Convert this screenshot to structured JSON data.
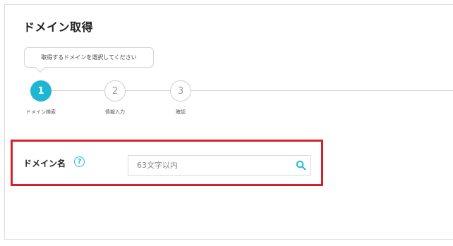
{
  "page": {
    "title": "ドメイン取得"
  },
  "tooltip": {
    "text": "取得するドメインを選択してください"
  },
  "steps": [
    {
      "number": "1",
      "label": "ドメイン検索",
      "active": true
    },
    {
      "number": "2",
      "label": "情報入力",
      "active": false
    },
    {
      "number": "3",
      "label": "確認",
      "active": false
    }
  ],
  "domain_search": {
    "label": "ドメイン名",
    "help_symbol": "?",
    "placeholder": "63文字以内",
    "value": ""
  },
  "colors": {
    "accent": "#1db7d4",
    "highlight_border": "#d1232a"
  },
  "icons": {
    "help": "question-circle-icon",
    "search": "magnifier-icon"
  }
}
